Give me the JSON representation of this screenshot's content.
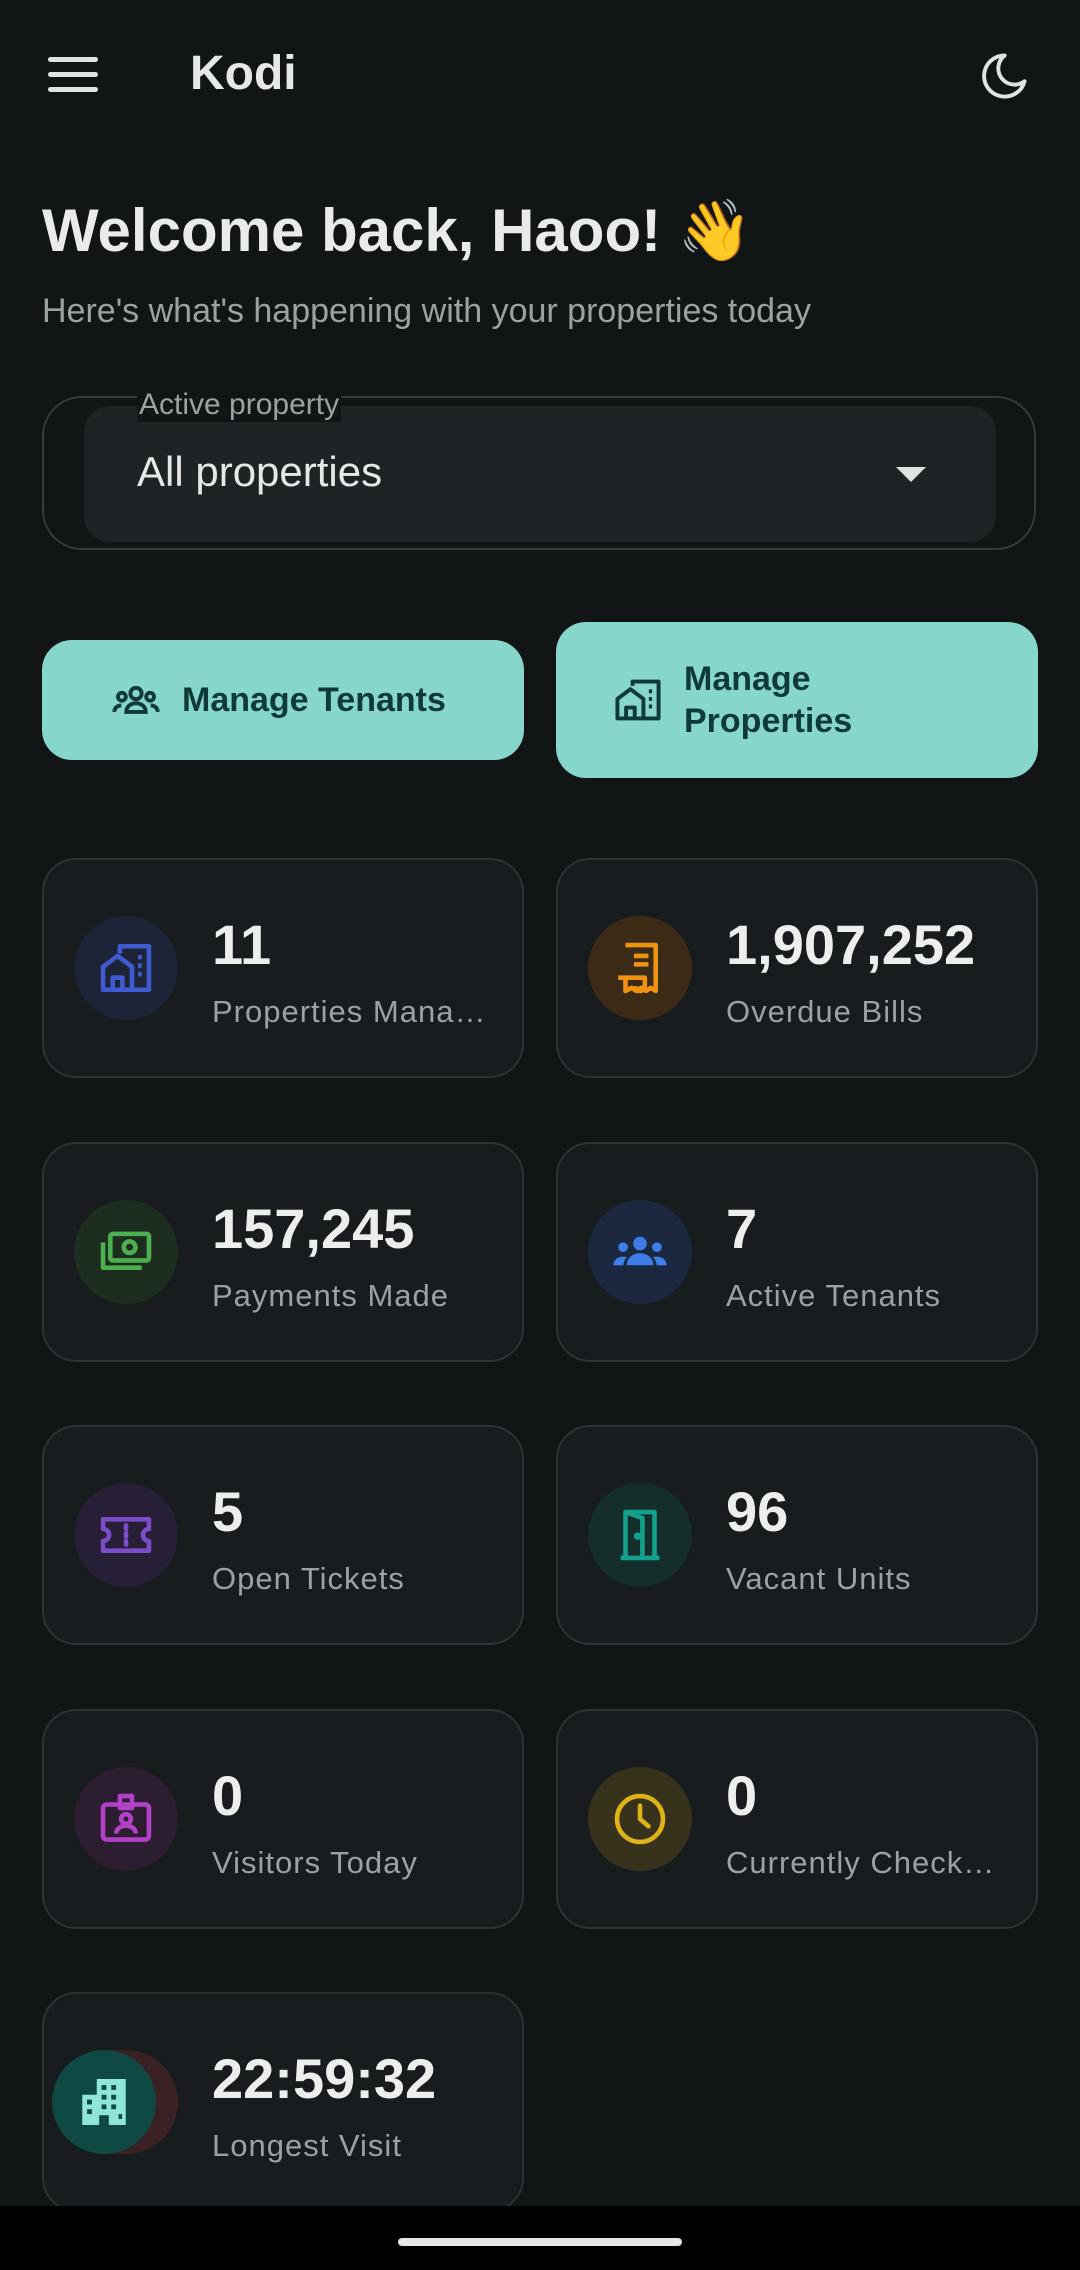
{
  "app": {
    "title": "Kodi"
  },
  "header": {
    "welcome": "Welcome back, Haoo! 👋",
    "subtitle": "Here's what's happening with your properties today"
  },
  "property_select": {
    "label": "Active property",
    "value": "All properties"
  },
  "actions": {
    "manage_tenants": "Manage Tenants",
    "manage_properties_line1": "Manage",
    "manage_properties_line2": "Properties"
  },
  "stats": [
    {
      "value": "11",
      "label": "Properties Mana…",
      "icon": "building-icon",
      "color": "#3f5bd1"
    },
    {
      "value": "1,907,252",
      "label": "Overdue Bills",
      "icon": "receipt-icon",
      "color": "#f0930f"
    },
    {
      "value": "157,245",
      "label": "Payments Made",
      "icon": "cash-icon",
      "color": "#4caf50"
    },
    {
      "value": "7",
      "label": "Active Tenants",
      "icon": "group-icon",
      "color": "#3f7ee8"
    },
    {
      "value": "5",
      "label": "Open Tickets",
      "icon": "ticket-icon",
      "color": "#7c4dca"
    },
    {
      "value": "96",
      "label": "Vacant Units",
      "icon": "door-icon",
      "color": "#14a08f"
    },
    {
      "value": "0",
      "label": "Visitors Today",
      "icon": "badge-icon",
      "color": "#b341c8"
    },
    {
      "value": "0",
      "label": "Currently Checke…",
      "icon": "clock-icon",
      "color": "#e0b21a"
    },
    {
      "value": "22:59:32",
      "label": "Longest Visit",
      "icon": "timer-icon",
      "color": "#c0433d"
    }
  ]
}
